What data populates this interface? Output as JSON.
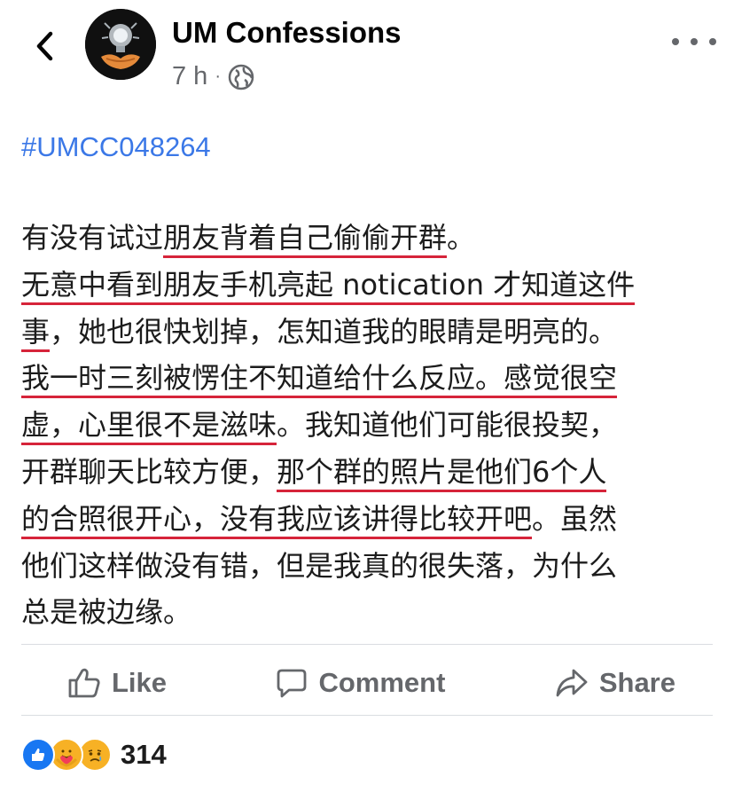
{
  "header": {
    "page_name": "UM Confessions",
    "time": "7 h",
    "separator": "·",
    "audience_icon": "globe-icon"
  },
  "post": {
    "hashtag": "#UMCC048264",
    "lines": [
      [
        {
          "t": "有没有试过"
        },
        {
          "t": "朋友背着自己偷偷开群",
          "u": true
        },
        {
          "t": "。"
        }
      ],
      [
        {
          "t": "无意中看到朋友手机亮起 notication 才知道这件",
          "u": true
        }
      ],
      [
        {
          "t": "事",
          "u": true
        },
        {
          "t": "，她也很快划掉，怎知道我的眼睛是明亮的。"
        }
      ],
      [
        {
          "t": "我一时三刻被愣住不知道给什么反应。感觉很空",
          "u": true
        }
      ],
      [
        {
          "t": "虚，心里很不是滋味",
          "u": true
        },
        {
          "t": "。我知道他们可能很投契，"
        }
      ],
      [
        {
          "t": "开群聊天比较方便，"
        },
        {
          "t": "那个群的照片是他们6个人",
          "u": true
        }
      ],
      [
        {
          "t": "的合照很开心，没有我应该讲得比较开吧",
          "u": true
        },
        {
          "t": "。虽然"
        }
      ],
      [
        {
          "t": "他们这样做没有错，但是我真的很失落，为什么"
        }
      ],
      [
        {
          "t": "总是被边缘。"
        }
      ]
    ],
    "underline_color": "#d6243a"
  },
  "actions": {
    "like": "Like",
    "comment": "Comment",
    "share": "Share"
  },
  "reactions": {
    "icons": [
      "like-reaction-icon",
      "care-reaction-icon",
      "sad-reaction-icon"
    ],
    "count": "314"
  },
  "colors": {
    "hashtag": "#3b78e7",
    "secondary_text": "#65676b",
    "like_blue": "#1877f2"
  }
}
